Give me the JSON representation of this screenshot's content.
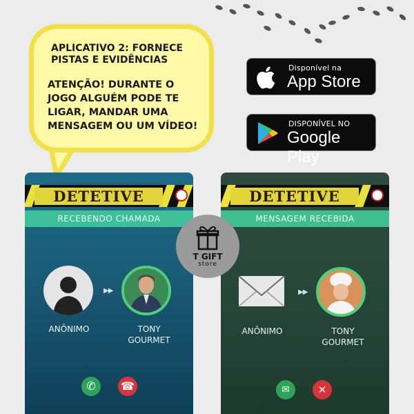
{
  "bubble": {
    "title_line1": "APLICATIVO 2: FORNECE",
    "title_line2": "PISTAS E EVIDÊNCIAS",
    "text_line1": "ATENÇÃO! DURANTE O",
    "text_line2": "JOGO ALGUÉM PODE TE",
    "text_line3": "LIGAR, MANDAR UMA",
    "text_line4": "MENSAGEM OU UM VÍDEO!"
  },
  "app_store": {
    "small": "Disponível na",
    "big": "App Store",
    "icon": "apple-icon"
  },
  "google_play": {
    "small": "DISPONÍVEL NO",
    "big": "Google Play",
    "icon": "play-icon"
  },
  "brand": {
    "name": "T GIFT",
    "sub": "store"
  },
  "phone_left": {
    "logo": "DETETIVE",
    "status": "RECEBENDO CHAMADA",
    "caller": "ANÔNIMO",
    "receiver_line1": "TONY",
    "receiver_line2": "GOURMET",
    "accept_icon": "phone-accept-icon",
    "decline_icon": "phone-decline-icon"
  },
  "phone_right": {
    "logo": "DETETIVE",
    "status": "MENSAGEM RECEBIDA",
    "caller": "ANÔNIMO",
    "receiver_line1": "TONY",
    "receiver_line2": "GOURMET",
    "open_icon": "open-message-icon",
    "close_icon": "close-icon"
  },
  "colors": {
    "bubble_fill": "#fff9a8",
    "bubble_border": "#f0e04a",
    "band_green": "#3dbf9a",
    "accept_green": "#2fa35a",
    "decline_red": "#d9343a"
  }
}
